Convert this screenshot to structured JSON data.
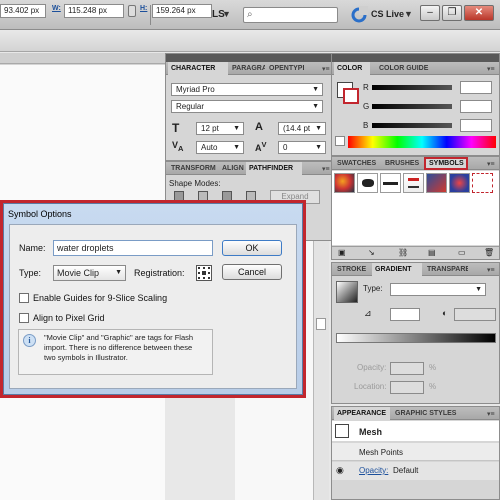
{
  "topbar": {
    "workspace": "ESSENTIALS",
    "cs_live": "CS Live",
    "window_min": "–",
    "window_max": "❐",
    "window_close": "✕"
  },
  "control_bar": {
    "x_value": "93.402 px",
    "w_label": "W:",
    "w_value": "115.248 px",
    "h_label": "H:",
    "h_value": "159.264 px"
  },
  "character_panel": {
    "tabs": [
      "CHARACTER",
      "PARAGRAPH",
      "OPENTYPE"
    ],
    "font_family": "Myriad Pro",
    "font_style": "Regular",
    "font_size": "12 pt",
    "leading": "(14.4 pt",
    "kerning": "Auto",
    "tracking": "0"
  },
  "pathfinder_panel": {
    "tabs": [
      "TRANSFORM",
      "ALIGN",
      "PATHFINDER"
    ],
    "shape_modes_label": "Shape Modes:",
    "expand_label": "Expand"
  },
  "color_panel": {
    "tabs": [
      "COLOR",
      "COLOR GUIDE"
    ],
    "channels": [
      "R",
      "G",
      "B"
    ],
    "accent": "#c2262e"
  },
  "symbols_panel": {
    "tabs": [
      "SWATCHES",
      "BRUSHES",
      "SYMBOLS"
    ]
  },
  "gradient_panel": {
    "tabs": [
      "STROKE",
      "GRADIENT",
      "TRANSPARENCY"
    ],
    "type_label": "Type:",
    "opacity_label": "Opacity:",
    "location_label": "Location:",
    "percent": "%"
  },
  "appearance_panel": {
    "tabs": [
      "APPEARANCE",
      "GRAPHIC STYLES"
    ],
    "title": "Mesh",
    "items": [
      "Mesh Points"
    ],
    "opacity_label": "Opacity:",
    "opacity_value": "Default"
  },
  "dialog": {
    "title": "Symbol Options",
    "name_label": "Name:",
    "name_value": "water droplets",
    "type_label": "Type:",
    "type_value": "Movie Clip",
    "registration_label": "Registration:",
    "ok_label": "OK",
    "cancel_label": "Cancel",
    "guides_label": "Enable Guides for 9-Slice Scaling",
    "pixel_grid_label": "Align to Pixel Grid",
    "info_text": "\"Movie Clip\" and \"Graphic\" are tags for Flash import. There is no difference between these two symbols in Illustrator."
  }
}
